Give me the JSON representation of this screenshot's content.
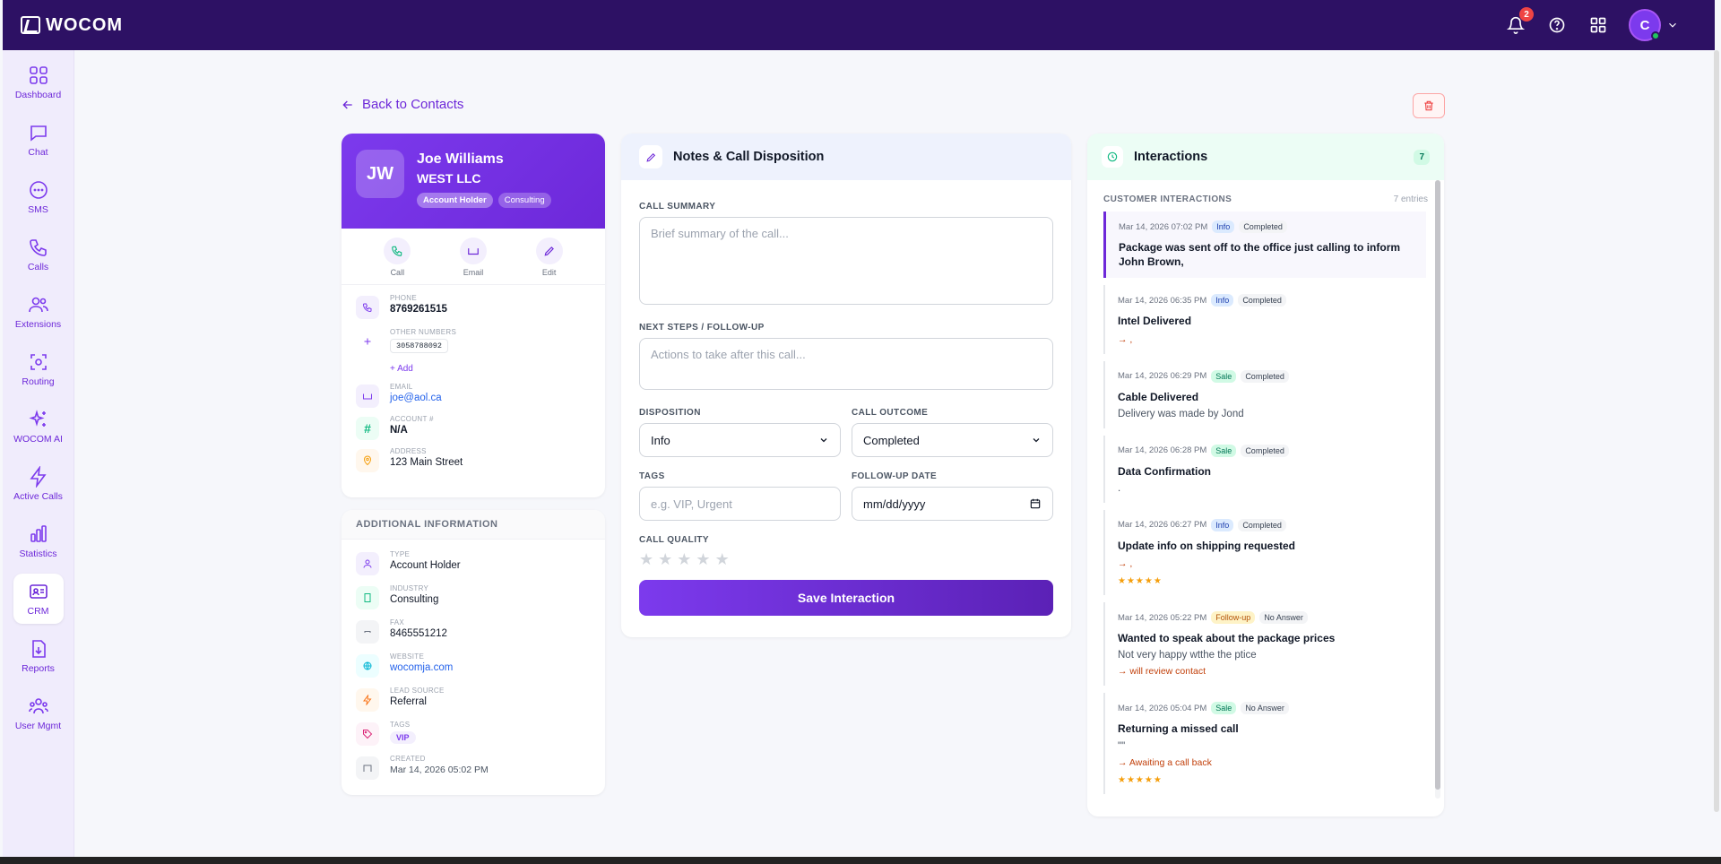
{
  "app": {
    "logo": "WOCOM"
  },
  "topbar": {
    "notifications_count": "2",
    "avatar_initial": "C"
  },
  "sidebar": {
    "items": [
      {
        "label": "Dashboard",
        "icon": "grid-icon"
      },
      {
        "label": "Chat",
        "icon": "chat-icon"
      },
      {
        "label": "SMS",
        "icon": "sms-icon"
      },
      {
        "label": "Calls",
        "icon": "phone-icon"
      },
      {
        "label": "Extensions",
        "icon": "users-icon"
      },
      {
        "label": "Routing",
        "icon": "routing-icon"
      },
      {
        "label": "WOCOM AI",
        "icon": "sparkle-icon"
      },
      {
        "label": "Active Calls",
        "icon": "bolt-icon"
      },
      {
        "label": "Statistics",
        "icon": "bar-chart-icon"
      },
      {
        "label": "CRM",
        "icon": "id-card-icon"
      },
      {
        "label": "Reports",
        "icon": "download-icon"
      },
      {
        "label": "User Mgmt",
        "icon": "team-icon"
      }
    ]
  },
  "nav": {
    "back_label": "Back to Contacts"
  },
  "contact": {
    "initials": "JW",
    "name": "Joe Williams",
    "company": "WEST LLC",
    "chips": [
      "Account Holder",
      "Consulting"
    ],
    "actions": {
      "call": "Call",
      "email": "Email",
      "edit": "Edit"
    },
    "phone_label": "PHONE",
    "phone": "8769261515",
    "other_numbers_label": "OTHER NUMBERS",
    "other_number": "3058788092",
    "add_label": "+ Add",
    "email_label": "EMAIL",
    "email": "joe@aol.ca",
    "account_label": "ACCOUNT #",
    "account": "N/A",
    "address_label": "ADDRESS",
    "address": "123 Main Street"
  },
  "additional": {
    "title": "ADDITIONAL INFORMATION",
    "type_label": "TYPE",
    "type": "Account Holder",
    "industry_label": "INDUSTRY",
    "industry": "Consulting",
    "fax_label": "FAX",
    "fax": "8465551212",
    "website_label": "WEBSITE",
    "website": "wocomja.com",
    "lead_label": "LEAD SOURCE",
    "lead": "Referral",
    "tags_label": "TAGS",
    "tag": "VIP",
    "created_label": "CREATED",
    "created": "Mar 14, 2026 05:02 PM"
  },
  "notes": {
    "title": "Notes & Call Disposition",
    "summary_label": "CALL SUMMARY",
    "summary_placeholder": "Brief summary of the call...",
    "next_label": "NEXT STEPS / FOLLOW-UP",
    "next_placeholder": "Actions to take after this call...",
    "disposition_label": "DISPOSITION",
    "disposition_value": "Info",
    "outcome_label": "CALL OUTCOME",
    "outcome_value": "Completed",
    "tags_label": "TAGS",
    "tags_placeholder": "e.g. VIP, Urgent",
    "followup_label": "FOLLOW-UP DATE",
    "followup_placeholder": "mm/dd/yyyy",
    "quality_label": "CALL QUALITY",
    "quality_rating": 0,
    "save_label": "Save Interaction"
  },
  "interactions": {
    "title": "Interactions",
    "count": "7",
    "subtitle": "CUSTOMER INTERACTIONS",
    "entries_label": "7 entries",
    "entries": [
      {
        "time": "Mar 14, 2026 07:02 PM",
        "type": "Info",
        "status": "Completed",
        "title": "Package was sent off to the office just calling to inform John Brown,"
      },
      {
        "time": "Mar 14, 2026 06:35 PM",
        "type": "Info",
        "status": "Completed",
        "title": "Intel Delivered",
        "next": "→ ,"
      },
      {
        "time": "Mar 14, 2026 06:29 PM",
        "type": "Sale",
        "status": "Completed",
        "title": "Cable Delivered",
        "note": "Delivery was made by Jond"
      },
      {
        "time": "Mar 14, 2026 06:28 PM",
        "type": "Sale",
        "status": "Completed",
        "title": "Data Confirmation",
        "note": "."
      },
      {
        "time": "Mar 14, 2026 06:27 PM",
        "type": "Info",
        "status": "Completed",
        "title": "Update info on shipping requested",
        "next": "→ ,",
        "stars": "★★★★★"
      },
      {
        "time": "Mar 14, 2026 05:22 PM",
        "type": "Follow-up",
        "status": "No Answer",
        "title": "Wanted to speak about the package prices",
        "note": "Not very happy wtthe the ptice",
        "next": "→ will review contact"
      },
      {
        "time": "Mar 14, 2026 05:04 PM",
        "type": "Sale",
        "status": "No Answer",
        "title": "Returning a missed call",
        "note": "\"\"",
        "next": "→ Awaiting a call back",
        "stars": "★★★★★"
      }
    ]
  }
}
